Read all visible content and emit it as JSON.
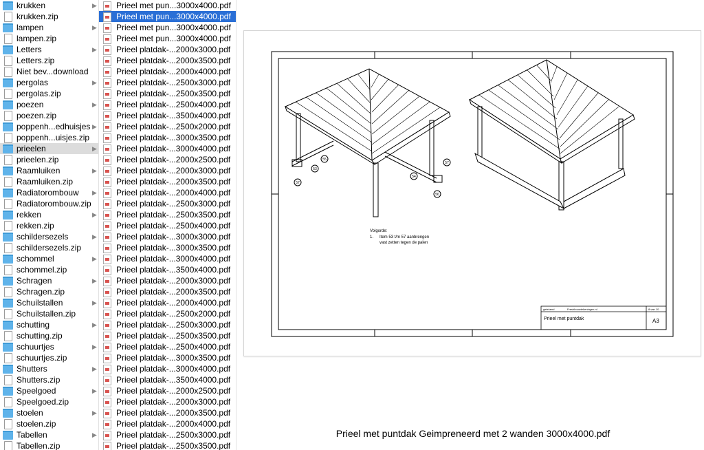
{
  "sidebar": {
    "items": [
      {
        "label": "krukken",
        "type": "folder",
        "chevron": true
      },
      {
        "label": "krukken.zip",
        "type": "file",
        "chevron": false
      },
      {
        "label": "lampen",
        "type": "folder",
        "chevron": true
      },
      {
        "label": "lampen.zip",
        "type": "file",
        "chevron": false
      },
      {
        "label": "Letters",
        "type": "folder",
        "chevron": true
      },
      {
        "label": "Letters.zip",
        "type": "file",
        "chevron": false
      },
      {
        "label": "Niet bev...download",
        "type": "file",
        "chevron": false
      },
      {
        "label": "pergolas",
        "type": "folder",
        "chevron": true
      },
      {
        "label": "pergolas.zip",
        "type": "file",
        "chevron": false
      },
      {
        "label": "poezen",
        "type": "folder",
        "chevron": true
      },
      {
        "label": "poezen.zip",
        "type": "file",
        "chevron": false
      },
      {
        "label": "poppenh...edhuisjes",
        "type": "folder",
        "chevron": true
      },
      {
        "label": "poppenh...uisjes.zip",
        "type": "file",
        "chevron": false
      },
      {
        "label": "prieelen",
        "type": "folder",
        "chevron": true,
        "selected": true
      },
      {
        "label": "prieelen.zip",
        "type": "file",
        "chevron": false
      },
      {
        "label": "Raamluiken",
        "type": "folder",
        "chevron": true
      },
      {
        "label": "Raamluiken.zip",
        "type": "file",
        "chevron": false
      },
      {
        "label": "Radiatorombouw",
        "type": "folder",
        "chevron": true
      },
      {
        "label": "Radiatorombouw.zip",
        "type": "file",
        "chevron": false
      },
      {
        "label": "rekken",
        "type": "folder",
        "chevron": true
      },
      {
        "label": "rekken.zip",
        "type": "file",
        "chevron": false
      },
      {
        "label": "schildersezels",
        "type": "folder",
        "chevron": true
      },
      {
        "label": "schildersezels.zip",
        "type": "file",
        "chevron": false
      },
      {
        "label": "schommel",
        "type": "folder",
        "chevron": true
      },
      {
        "label": "schommel.zip",
        "type": "file",
        "chevron": false
      },
      {
        "label": "Schragen",
        "type": "folder",
        "chevron": true
      },
      {
        "label": "Schragen.zip",
        "type": "file",
        "chevron": false
      },
      {
        "label": "Schuilstallen",
        "type": "folder",
        "chevron": true
      },
      {
        "label": "Schuilstallen.zip",
        "type": "file",
        "chevron": false
      },
      {
        "label": "schutting",
        "type": "folder",
        "chevron": true
      },
      {
        "label": "schutting.zip",
        "type": "file",
        "chevron": false
      },
      {
        "label": "schuurtjes",
        "type": "folder",
        "chevron": true
      },
      {
        "label": "schuurtjes.zip",
        "type": "file",
        "chevron": false
      },
      {
        "label": "Shutters",
        "type": "folder",
        "chevron": true
      },
      {
        "label": "Shutters.zip",
        "type": "file",
        "chevron": false
      },
      {
        "label": "Speelgoed",
        "type": "folder",
        "chevron": true
      },
      {
        "label": "Speelgoed.zip",
        "type": "file",
        "chevron": false
      },
      {
        "label": "stoelen",
        "type": "folder",
        "chevron": true
      },
      {
        "label": "stoelen.zip",
        "type": "file",
        "chevron": false
      },
      {
        "label": "Tabellen",
        "type": "folder",
        "chevron": true
      },
      {
        "label": "Tabellen.zip",
        "type": "file",
        "chevron": false
      }
    ]
  },
  "files": {
    "items": [
      {
        "label": "Prieel met pun...3000x4000.pdf"
      },
      {
        "label": "Prieel met pun...3000x4000.pdf",
        "selected": true
      },
      {
        "label": "Prieel met pun...3000x4000.pdf"
      },
      {
        "label": "Prieel met pun...3000x4000.pdf"
      },
      {
        "label": "Prieel platdak-...2000x3000.pdf"
      },
      {
        "label": "Prieel platdak-...2000x3500.pdf"
      },
      {
        "label": "Prieel platdak-...2000x4000.pdf"
      },
      {
        "label": "Prieel platdak-...2500x3000.pdf"
      },
      {
        "label": "Prieel platdak-...2500x3500.pdf"
      },
      {
        "label": "Prieel platdak-...2500x4000.pdf"
      },
      {
        "label": "Prieel platdak-...3500x4000.pdf"
      },
      {
        "label": "Prieel platdak-...2500x2000.pdf"
      },
      {
        "label": "Prieel platdak-...3000x3500.pdf"
      },
      {
        "label": "Prieel platdak-...3000x4000.pdf"
      },
      {
        "label": "Prieel platdak-...2000x2500.pdf"
      },
      {
        "label": "Prieel platdak-...2000x3000.pdf"
      },
      {
        "label": "Prieel platdak-...2000x3500.pdf"
      },
      {
        "label": "Prieel platdak-...2000x4000.pdf"
      },
      {
        "label": "Prieel platdak-...2500x3000.pdf"
      },
      {
        "label": "Prieel platdak-...2500x3500.pdf"
      },
      {
        "label": "Prieel platdak-...2500x4000.pdf"
      },
      {
        "label": "Prieel platdak-...3000x3000.pdf"
      },
      {
        "label": "Prieel platdak-...3000x3500.pdf"
      },
      {
        "label": "Prieel platdak-...3000x4000.pdf"
      },
      {
        "label": "Prieel platdak-...3500x4000.pdf"
      },
      {
        "label": "Prieel platdak-...2000x3000.pdf"
      },
      {
        "label": "Prieel platdak-...2000x3500.pdf"
      },
      {
        "label": "Prieel platdak-...2000x4000.pdf"
      },
      {
        "label": "Prieel platdak-...2500x2000.pdf"
      },
      {
        "label": "Prieel platdak-...2500x3000.pdf"
      },
      {
        "label": "Prieel platdak-...2500x3500.pdf"
      },
      {
        "label": "Prieel platdak-...2500x4000.pdf"
      },
      {
        "label": "Prieel platdak-...3000x3500.pdf"
      },
      {
        "label": "Prieel platdak-...3000x4000.pdf"
      },
      {
        "label": "Prieel platdak-...3500x4000.pdf"
      },
      {
        "label": "Prieel platdak-...2000x2500.pdf"
      },
      {
        "label": "Prieel platdak-...2000x3000.pdf"
      },
      {
        "label": "Prieel platdak-...2000x3500.pdf"
      },
      {
        "label": "Prieel platdak-...2000x4000.pdf"
      },
      {
        "label": "Prieel platdak-...2500x3000.pdf"
      },
      {
        "label": "Prieel platdak-...2500x3500.pdf"
      }
    ]
  },
  "preview": {
    "notes_title": "Volgorde:",
    "notes_num": "1.",
    "notes_line1": "Item 53 t/m 57 aanbrengen",
    "notes_line2": "vast zetten tegen de palen",
    "callouts": [
      "53",
      "55",
      "57",
      "54",
      "57",
      "56"
    ],
    "title_block": {
      "drawn_label": "getekend",
      "site": "Freshbouwtekeningen.nl",
      "sheet": "8 van 10",
      "drawing_title": "Prieel met puntdak",
      "format": "A3"
    }
  },
  "caption": "Prieel met puntdak Geimpreneerd met 2 wanden 3000x4000.pdf"
}
